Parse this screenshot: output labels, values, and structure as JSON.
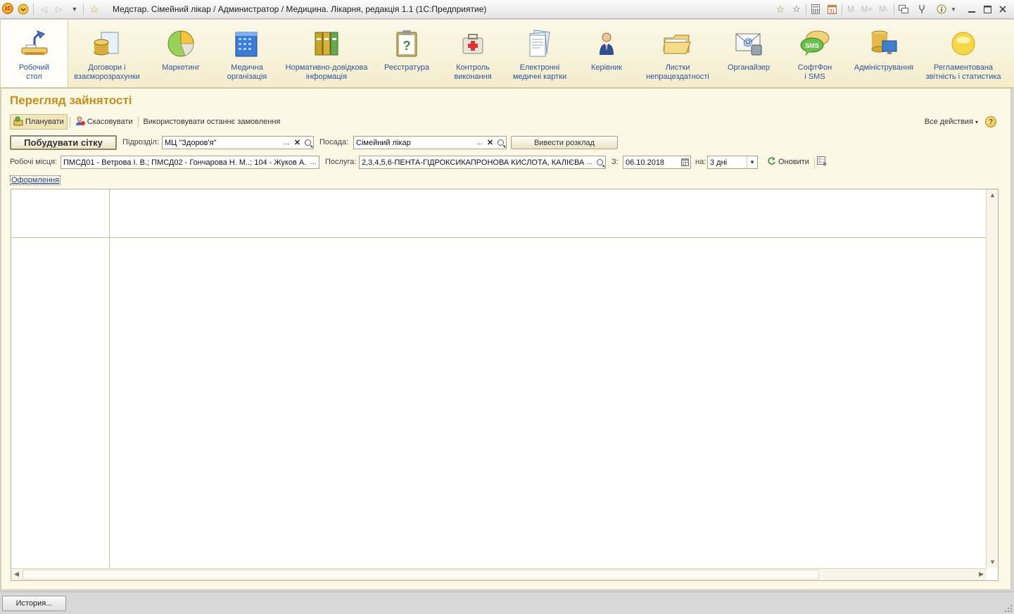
{
  "window": {
    "title": "Медстар. Сімейний лікар / Администратор / Медицина. Лікарня, редакція 1.1  (1С:Предприятие)",
    "toolbar_m": "M",
    "toolbar_mplus": "M+",
    "toolbar_mminus": "M-",
    "calendar_day": "31",
    "logo_text": "1С"
  },
  "sections": [
    {
      "label": "Робочий\nстол",
      "icon": "desk-lamp-icon",
      "active": true
    },
    {
      "label": "Договори і\nвзаєморозрахунки",
      "icon": "coins-contracts-icon"
    },
    {
      "label": "Маркетинг",
      "icon": "pie-chart-icon"
    },
    {
      "label": "Медична\nорганізація",
      "icon": "building-icon"
    },
    {
      "label": "Нормативно-довідкова\nінформація",
      "icon": "binders-icon"
    },
    {
      "label": "Реєстратура",
      "icon": "clipboard-question-icon"
    },
    {
      "label": "Контроль\nвиконання",
      "icon": "first-aid-kit-icon"
    },
    {
      "label": "Електронні\nмедичні картки",
      "icon": "documents-stack-icon"
    },
    {
      "label": "Керівник",
      "icon": "manager-person-icon"
    },
    {
      "label": "Листки\nнепрацездатності",
      "icon": "folder-papers-icon"
    },
    {
      "label": "Органайзер",
      "icon": "envelope-at-icon"
    },
    {
      "label": "СофтФон\nі SMS",
      "icon": "sms-bubble-icon"
    },
    {
      "label": "Адміністрування",
      "icon": "database-monitor-icon"
    },
    {
      "label": "Регламентована\nзвітність і статистика",
      "icon": "yellow-circle-icon"
    }
  ],
  "page": {
    "title": "Перегляд зайнятості",
    "commands": {
      "plan": "Планувати",
      "cancel": "Скасовувати",
      "use_last": "Використовувати останнє замовлення",
      "all_actions": "Все действия",
      "all_actions_arrow": "▾",
      "help": "?"
    },
    "build_grid": "Побудувати сітку",
    "division_label": "Підрозділ:",
    "division_value": "МЦ \"Здоров'я\"",
    "position_label": "Посада:",
    "position_value": "Сімейний лікар",
    "show_schedule": "Вивести розклад",
    "workplaces_label": "Робочі місця:",
    "workplaces_value": "ПМСД01 - Ветрова І. В.; ПМСД02 - Гончарова Н. М..; 104 - Жуков А.",
    "service_label": "Послуга:",
    "service_value": "2,3,4,5,6-ПЕНТА-ГІДРОКСИКАПРОНОВА КИСЛОТА, КАЛІЄВА",
    "from_label": "З:",
    "from_value": "06.10.2018",
    "for_label": "на:",
    "for_value": "3 дні",
    "refresh": "Оновити",
    "design_link": "Оформлення",
    "ellipsis": "...",
    "clear": "✕"
  },
  "footer": {
    "history_button": "История..."
  },
  "colors": {
    "title_accent": "#c78d1b",
    "section_label": "#2f5496",
    "panel_bg": "#fbf8e6"
  }
}
